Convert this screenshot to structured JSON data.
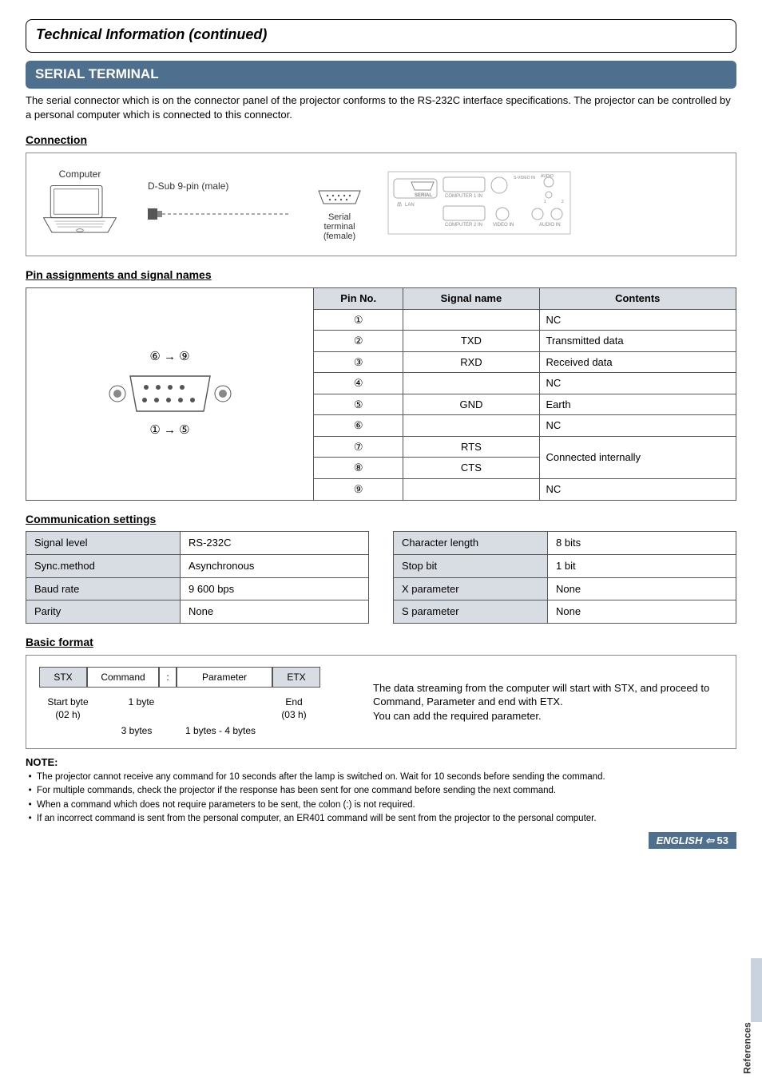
{
  "header": {
    "title": "Technical Information (continued)"
  },
  "terminal": {
    "title": "SERIAL TERMINAL",
    "intro": "The serial connector which is on the connector panel of the projector conforms to the RS-232C interface specifications. The projector can be controlled by a personal computer which is connected to this connector."
  },
  "connection": {
    "heading": "Connection",
    "computer_label": "Computer",
    "dsub_label": "D-Sub 9-pin (male)",
    "serial_label_1": "Serial",
    "serial_label_2": "terminal",
    "serial_label_3": "(female)",
    "panel_lan": "LAN",
    "panel_serial": "SERIAL",
    "panel_c1": "COMPUTER 1 IN",
    "panel_c2": "COMPUTER 2 IN",
    "panel_video": "VIDEO IN",
    "panel_audio": "AUDIO IN",
    "panel_sv": "S-VIDEO IN",
    "panel_aout": "AUDIO OUT"
  },
  "pins": {
    "heading": "Pin assignments and signal names",
    "diagram_top": "⑥ → ⑨",
    "diagram_bottom": "① → ⑤",
    "cols": {
      "pin": "Pin No.",
      "signal": "Signal name",
      "contents": "Contents"
    },
    "rows": [
      {
        "no": "①",
        "signal": "",
        "contents": "NC"
      },
      {
        "no": "②",
        "signal": "TXD",
        "contents": "Transmitted data"
      },
      {
        "no": "③",
        "signal": "RXD",
        "contents": "Received data"
      },
      {
        "no": "④",
        "signal": "",
        "contents": "NC"
      },
      {
        "no": "⑤",
        "signal": "GND",
        "contents": "Earth"
      },
      {
        "no": "⑥",
        "signal": "",
        "contents": "NC"
      },
      {
        "no": "⑦",
        "signal": "RTS",
        "contents": "Connected internally"
      },
      {
        "no": "⑧",
        "signal": "CTS",
        "contents": ""
      },
      {
        "no": "⑨",
        "signal": "",
        "contents": "NC"
      }
    ]
  },
  "comm": {
    "heading": "Communication settings",
    "left": [
      {
        "label": "Signal level",
        "value": "RS-232C"
      },
      {
        "label": "Sync.method",
        "value": "Asynchronous"
      },
      {
        "label": "Baud rate",
        "value": "9 600 bps"
      },
      {
        "label": "Parity",
        "value": "None"
      }
    ],
    "right": [
      {
        "label": "Character length",
        "value": "8 bits"
      },
      {
        "label": "Stop bit",
        "value": "1 bit"
      },
      {
        "label": "X parameter",
        "value": "None"
      },
      {
        "label": "S parameter",
        "value": "None"
      }
    ]
  },
  "format": {
    "heading": "Basic format",
    "cells": {
      "stx": "STX",
      "command": "Command",
      "colon": ":",
      "parameter": "Parameter",
      "etx": "ETX"
    },
    "ann": {
      "start1": "Start byte",
      "start2": "(02 h)",
      "cmd1": "1 byte",
      "end1": "End",
      "end2": "(03 h)",
      "bytes3": "3 bytes",
      "bytes14": "1 bytes - 4 bytes"
    },
    "desc": "The data streaming from the computer will start with STX, and proceed to Command, Parameter and end with ETX.\nYou can add the required parameter."
  },
  "notes": {
    "title": "NOTE:",
    "items": [
      "The projector cannot receive any command for 10 seconds after the lamp is switched on. Wait for 10 seconds before sending the command.",
      "For multiple commands, check the projector if the response has been sent for one command before sending the next command.",
      "When a command which does not require parameters to be sent, the colon (:) is not required.",
      "If an incorrect command is sent from the personal computer, an ER401 command will be sent from the projector to the personal computer."
    ]
  },
  "side_tab": "References",
  "footer": {
    "english": "ENGLISH",
    "arrow": "⇦",
    "page": "53"
  }
}
